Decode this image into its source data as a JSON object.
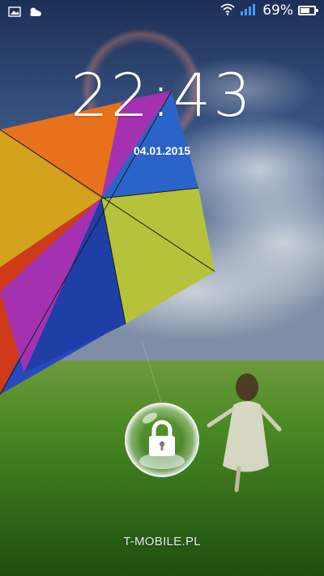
{
  "statusbar": {
    "left_icons": [
      "gallery-icon",
      "weather-icon"
    ],
    "right_icons": [
      "wifi-icon",
      "signal-icon",
      "battery-icon"
    ],
    "battery_percent": "69%",
    "battery_level": 0.69
  },
  "lockscreen": {
    "time": "22:43",
    "date": "04.01.2015",
    "carrier": "T-MOBILE.PL",
    "unlock_icon": "padlock-icon"
  },
  "colors": {
    "sky": "#2b3f66",
    "grass": "#3f7a22",
    "text": "#ffffff"
  }
}
